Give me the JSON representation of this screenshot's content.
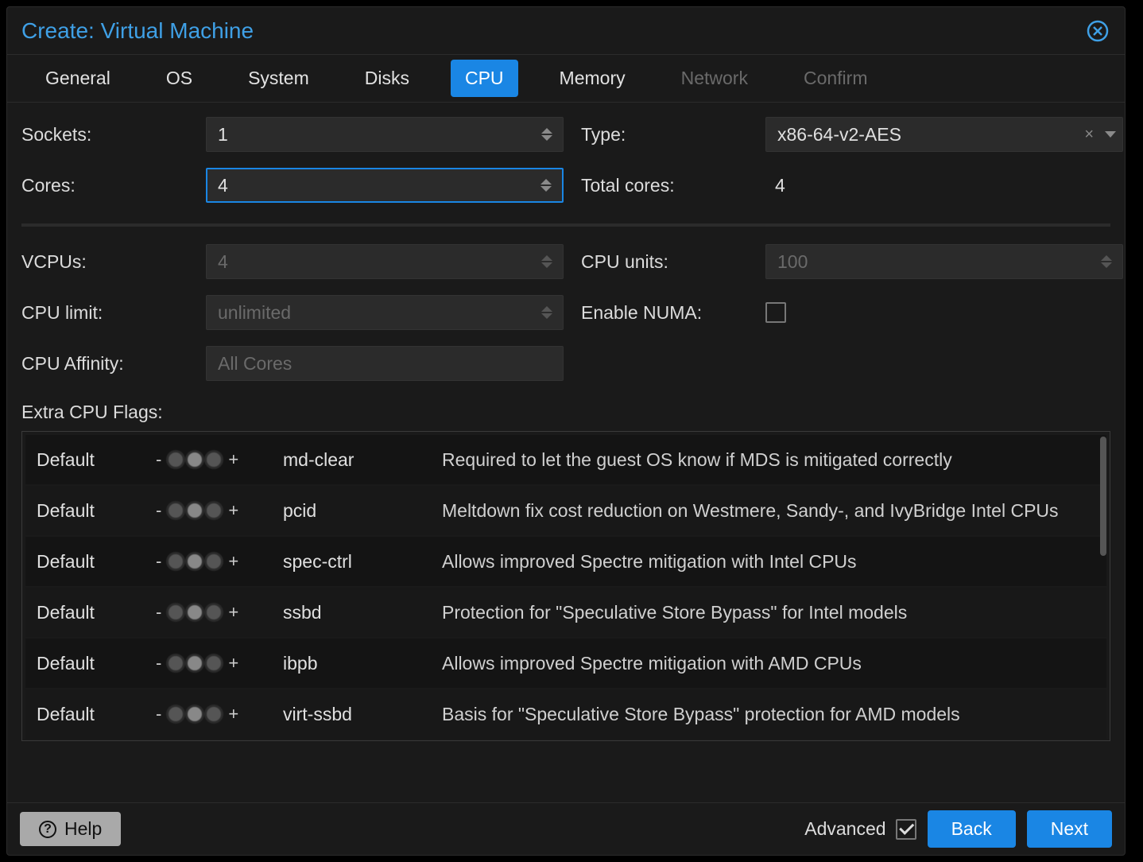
{
  "dialog": {
    "title": "Create: Virtual Machine"
  },
  "tabs": [
    {
      "label": "General",
      "state": "normal"
    },
    {
      "label": "OS",
      "state": "normal"
    },
    {
      "label": "System",
      "state": "normal"
    },
    {
      "label": "Disks",
      "state": "normal"
    },
    {
      "label": "CPU",
      "state": "active"
    },
    {
      "label": "Memory",
      "state": "normal"
    },
    {
      "label": "Network",
      "state": "disabled"
    },
    {
      "label": "Confirm",
      "state": "disabled"
    }
  ],
  "cpu": {
    "sockets": {
      "label": "Sockets:",
      "value": "1"
    },
    "cores": {
      "label": "Cores:",
      "value": "4"
    },
    "type": {
      "label": "Type:",
      "value": "x86-64-v2-AES"
    },
    "total": {
      "label": "Total cores:",
      "value": "4"
    },
    "vcpus": {
      "label": "VCPUs:",
      "value": "4"
    },
    "cpuunits": {
      "label": "CPU units:",
      "value": "100"
    },
    "cpulimit": {
      "label": "CPU limit:",
      "placeholder": "unlimited"
    },
    "numa": {
      "label": "Enable NUMA:",
      "checked": false
    },
    "affinity": {
      "label": "CPU Affinity:",
      "placeholder": "All Cores"
    }
  },
  "flags": {
    "label": "Extra CPU Flags:",
    "state_default": "Default",
    "rows": [
      {
        "name": "md-clear",
        "desc": "Required to let the guest OS know if MDS is mitigated correctly"
      },
      {
        "name": "pcid",
        "desc": "Meltdown fix cost reduction on Westmere, Sandy-, and IvyBridge Intel CPUs"
      },
      {
        "name": "spec-ctrl",
        "desc": "Allows improved Spectre mitigation with Intel CPUs"
      },
      {
        "name": "ssbd",
        "desc": "Protection for \"Speculative Store Bypass\" for Intel models"
      },
      {
        "name": "ibpb",
        "desc": "Allows improved Spectre mitigation with AMD CPUs"
      },
      {
        "name": "virt-ssbd",
        "desc": "Basis for \"Speculative Store Bypass\" protection for AMD models"
      }
    ]
  },
  "footer": {
    "help": "Help",
    "advanced": "Advanced",
    "advanced_checked": true,
    "back": "Back",
    "next": "Next"
  }
}
